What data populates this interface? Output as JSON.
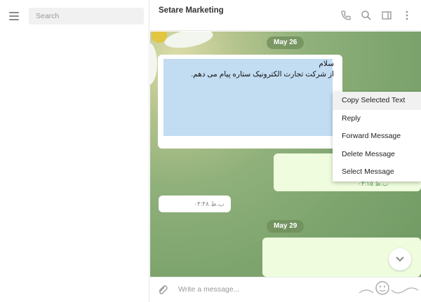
{
  "sidebar": {
    "search_placeholder": "Search"
  },
  "header": {
    "title": "Setare Marketing"
  },
  "chat": {
    "dates": [
      "May 26",
      "May 29"
    ],
    "selected_message": {
      "line1": "سلام",
      "line2": "از شرکت تجارت الکترونیک ستاره پیام می دهم."
    },
    "out_message_time": "۰۴:۱۵ ب.ظ",
    "in_message_time": "۰۴:۴۸ ب.ظ"
  },
  "context_menu": {
    "items": [
      "Copy Selected Text",
      "Reply",
      "Forward Message",
      "Delete Message",
      "Select Message"
    ]
  },
  "composer": {
    "placeholder": "Write a message..."
  },
  "colors": {
    "selection": "#c2dcf2",
    "outgoing": "#effdde",
    "accent": "#67a76a"
  },
  "icons": [
    "menu-icon",
    "phone-icon",
    "search-icon",
    "sidebar-toggle-icon",
    "more-icon",
    "attach-icon",
    "chevron-down-icon"
  ]
}
